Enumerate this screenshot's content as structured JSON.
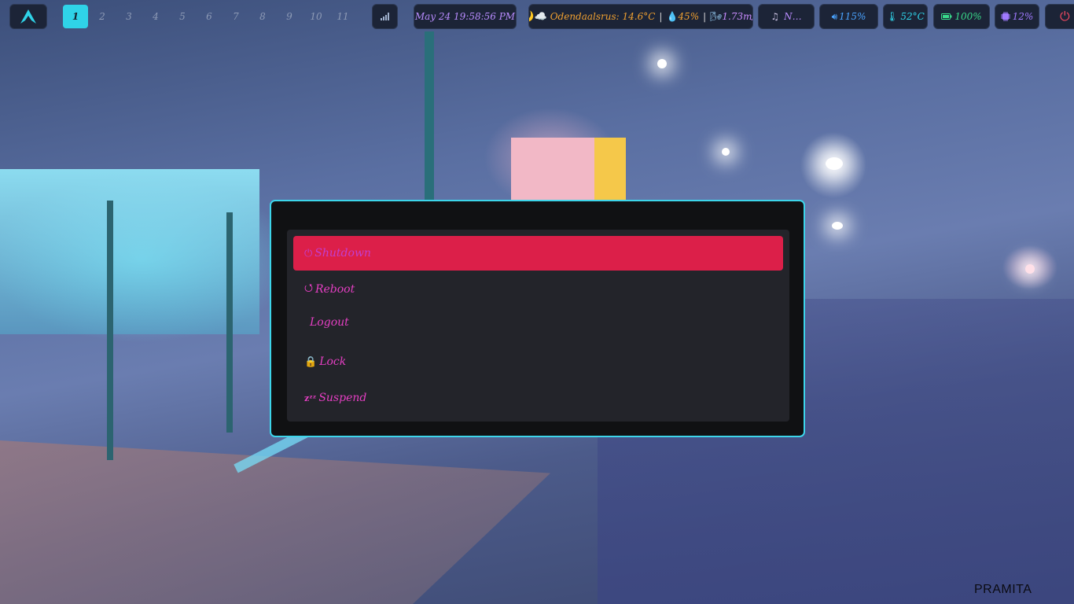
{
  "topbar": {
    "logo_icon": "arch-logo-icon",
    "workspaces": [
      "1",
      "2",
      "3",
      "4",
      "5",
      "6",
      "7",
      "8",
      "9",
      "10",
      "11"
    ],
    "active_workspace": "1",
    "network_icon": "signal-bars-icon",
    "clock": "May 24 19:58:56 PM",
    "weather": {
      "icons": "🌙☁️",
      "location_temp": "Odendaalsrus: 14.6°C",
      "humidity": "45%",
      "wind": "1.73m/s"
    },
    "media": {
      "label": "N…"
    },
    "volume": "115%",
    "temperature": "52°C",
    "battery": "100%",
    "cpu": "12%",
    "power_icon": "power-icon"
  },
  "power_menu": {
    "items": [
      {
        "icon": "⏻",
        "label": "Shutdown"
      },
      {
        "icon": "⭯",
        "label": "Reboot"
      },
      {
        "icon": "",
        "label": "Logout"
      },
      {
        "icon": "🔒",
        "label": "Lock"
      },
      {
        "icon": "zᶻᶻ",
        "label": "Suspend"
      }
    ],
    "selected_index": 0
  },
  "colors": {
    "accent": "#2fd3e8",
    "selected": "#dc1f49",
    "menu_text": "#e53fc3",
    "weather_text": "#f0a030",
    "volume_text": "#4aa3ff",
    "temp_text": "#2fd3e8",
    "battery_text": "#39d98a",
    "cpu_text": "#a07aff",
    "power_text": "#f04860"
  },
  "watermark": "PRAMITA"
}
